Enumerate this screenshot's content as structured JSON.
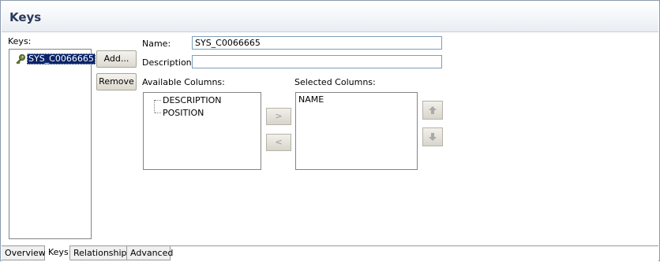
{
  "header": {
    "title": "Keys"
  },
  "keys": {
    "label": "Keys:",
    "items": [
      {
        "label": "SYS_C0066665",
        "icon": "key-icon",
        "selected": true
      }
    ],
    "add_button": "Add...",
    "remove_button": "Remove"
  },
  "form": {
    "name_label": "Name:",
    "name_value": "SYS_C0066665",
    "description_label": "Description:",
    "description_value": ""
  },
  "columns": {
    "available_label": "Available Columns:",
    "available": [
      "DESCRIPTION",
      "POSITION"
    ],
    "selected_label": "Selected Columns:",
    "selected": [
      "NAME"
    ],
    "add_arrow": ">",
    "remove_arrow": "<",
    "move_up_icon": "arrow-up-icon",
    "move_down_icon": "arrow-down-icon"
  },
  "tabs": [
    {
      "label": "Overview",
      "active": false
    },
    {
      "label": "Keys",
      "active": true
    },
    {
      "label": "Relationships",
      "active": false
    },
    {
      "label": "Advanced",
      "active": false
    }
  ],
  "colors": {
    "selection": "#0a246a",
    "title": "#2a3a5a"
  }
}
